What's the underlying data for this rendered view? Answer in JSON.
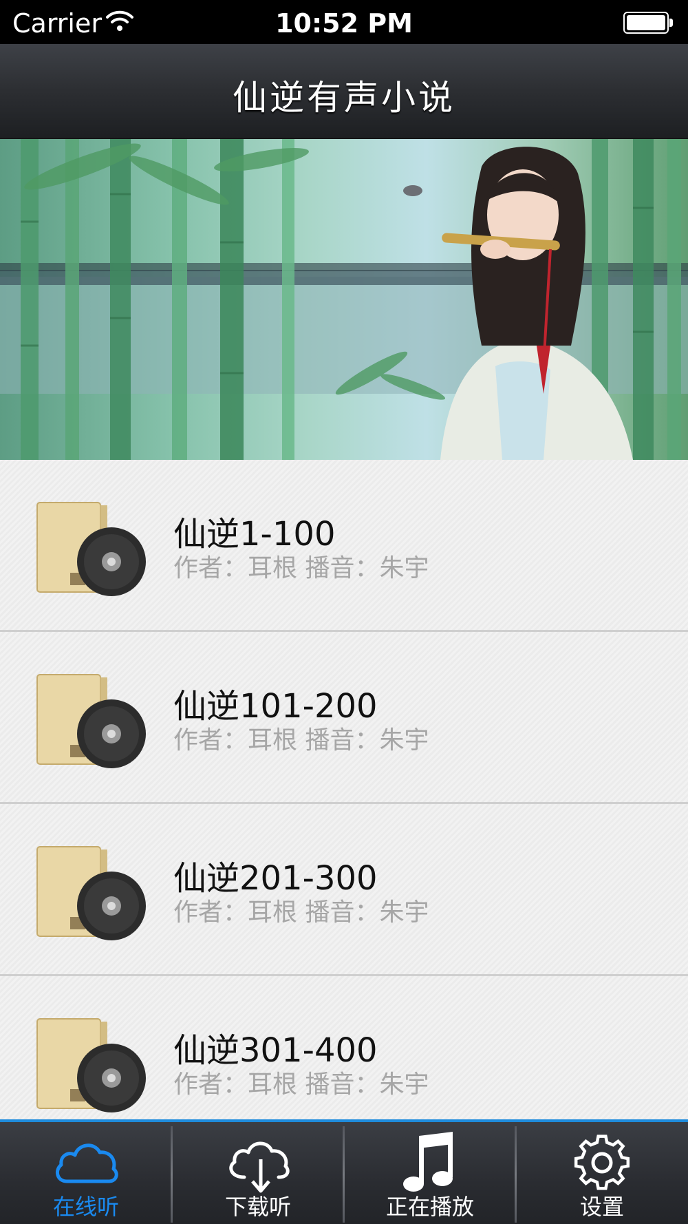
{
  "status_bar": {
    "carrier": "Carrier",
    "time": "10:52 PM"
  },
  "nav": {
    "title": "仙逆有声小说"
  },
  "list": {
    "items": [
      {
        "title": "仙逆1-100",
        "meta": "作者：耳根  播音：朱宇"
      },
      {
        "title": "仙逆101-200",
        "meta": "作者：耳根  播音：朱宇"
      },
      {
        "title": "仙逆201-300",
        "meta": "作者：耳根  播音：朱宇"
      },
      {
        "title": "仙逆301-400",
        "meta": "作者：耳根  播音：朱宇"
      }
    ]
  },
  "tab_bar": {
    "tabs": [
      {
        "label": "在线听",
        "icon": "cloud-icon",
        "active": true
      },
      {
        "label": "下载听",
        "icon": "cloud-download-icon",
        "active": false
      },
      {
        "label": "正在播放",
        "icon": "music-note-icon",
        "active": false
      },
      {
        "label": "设置",
        "icon": "gear-icon",
        "active": false
      }
    ]
  },
  "colors": {
    "accent": "#1a8af0",
    "nav_bg": "#2c2e32",
    "meta_text": "#a6a6a6"
  }
}
